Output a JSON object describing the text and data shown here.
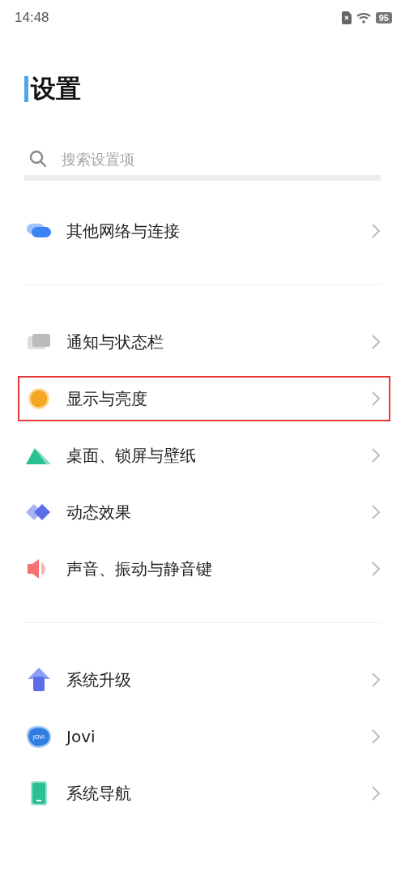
{
  "status_bar": {
    "time": "14:48",
    "battery": "95"
  },
  "title": "设置",
  "search": {
    "placeholder": "搜索设置项"
  },
  "groups": [
    {
      "items": [
        {
          "label": "其他网络与连接",
          "highlighted": false
        }
      ]
    },
    {
      "items": [
        {
          "label": "通知与状态栏",
          "highlighted": false
        },
        {
          "label": "显示与亮度",
          "highlighted": true
        },
        {
          "label": "桌面、锁屏与壁纸",
          "highlighted": false
        },
        {
          "label": "动态效果",
          "highlighted": false
        },
        {
          "label": "声音、振动与静音键",
          "highlighted": false
        }
      ]
    },
    {
      "items": [
        {
          "label": "系统升级",
          "highlighted": false
        },
        {
          "label": "Jovi",
          "icon_text": "JOVI",
          "highlighted": false
        },
        {
          "label": "系统导航",
          "highlighted": false
        }
      ]
    }
  ]
}
